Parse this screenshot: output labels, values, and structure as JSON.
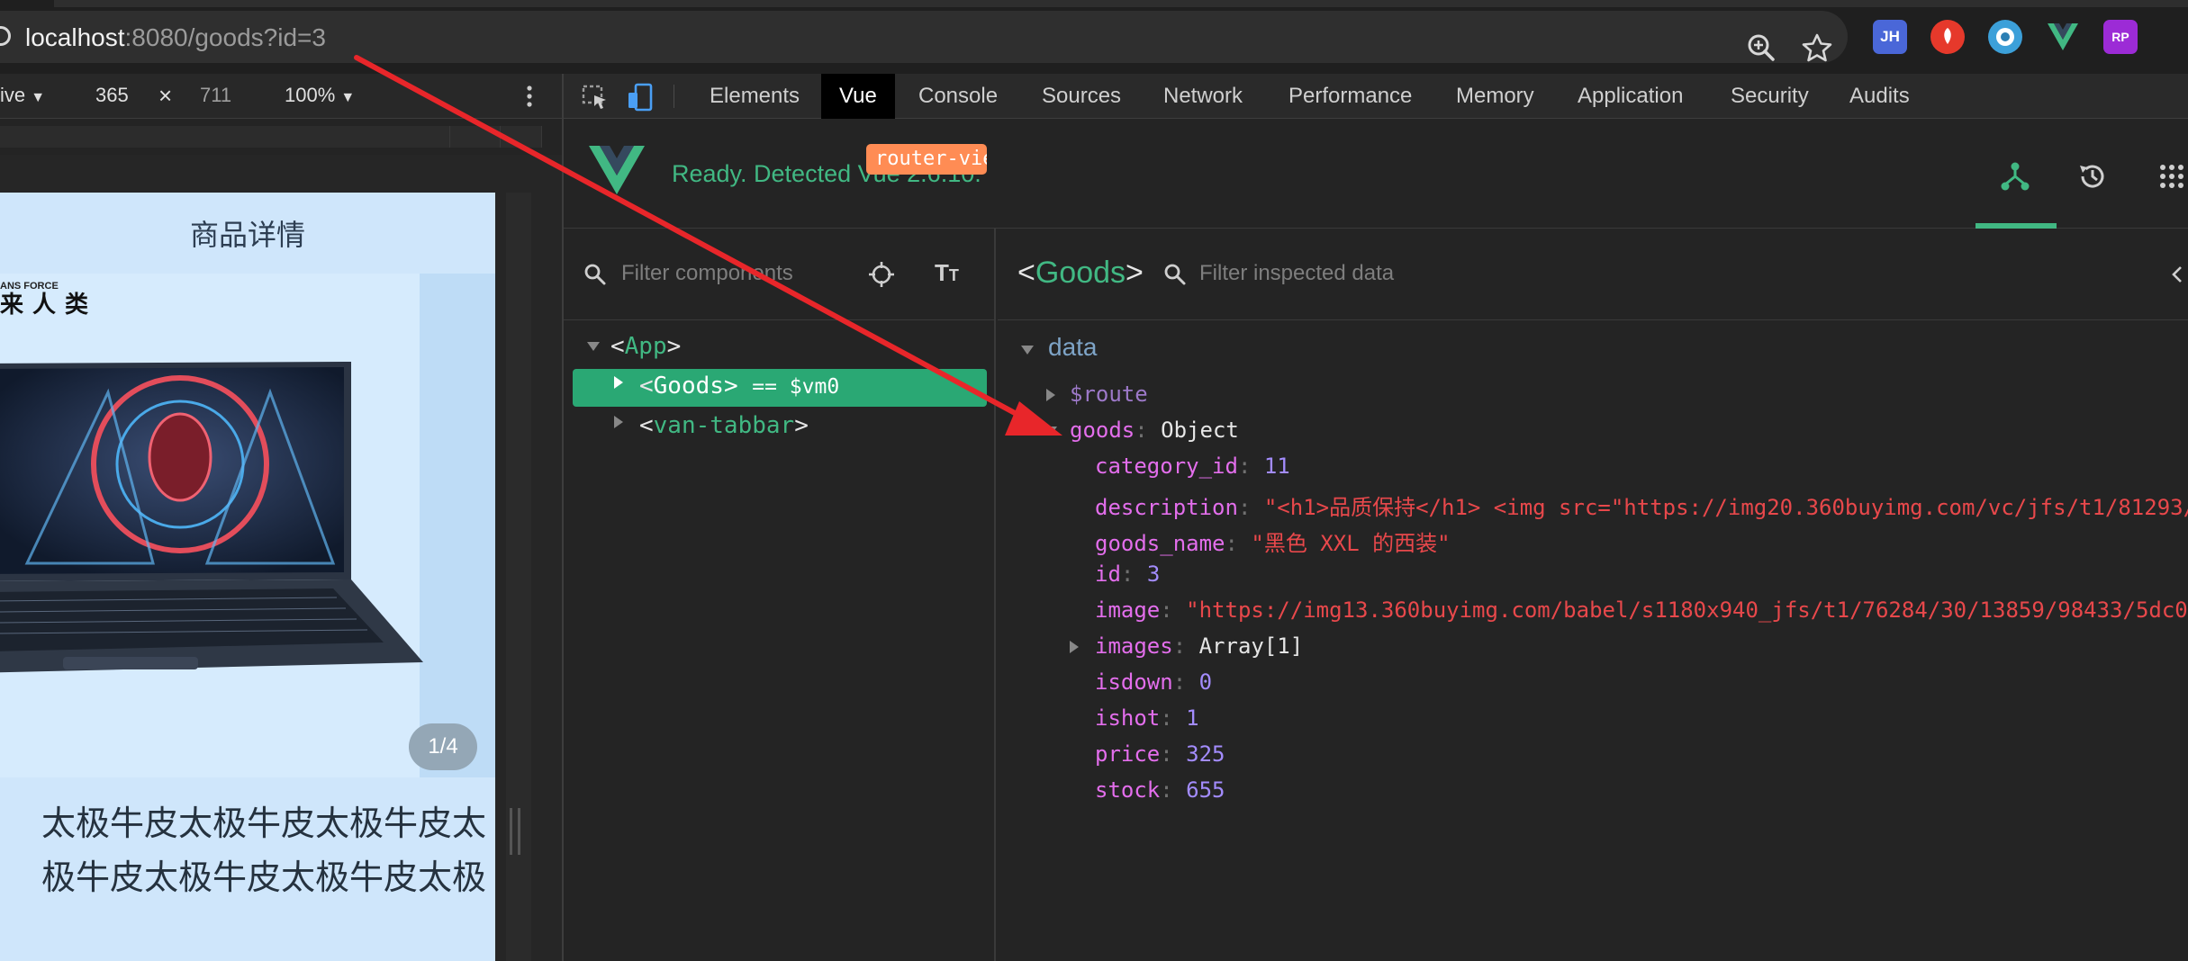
{
  "browser": {
    "url_host": "localhost",
    "url_rest": ":8080/goods?id=3",
    "extensions": [
      {
        "name": "jh-extension-icon",
        "label": "JH",
        "color": "#4a67d8"
      },
      {
        "name": "rocket-extension-icon",
        "label": "",
        "color": "#e6392b"
      },
      {
        "name": "eye-extension-icon",
        "label": "",
        "color": "#3ca0d9"
      },
      {
        "name": "vue-devtools-extension-icon",
        "label": "",
        "color": "#41b883"
      },
      {
        "name": "rp-extension-icon",
        "label": "RP",
        "color": "#9c2bd6"
      }
    ]
  },
  "device_toolbar": {
    "mode": "ive",
    "width": "365",
    "times": "×",
    "height": "711",
    "zoom": "100%"
  },
  "phone": {
    "title": "商品详情",
    "brand_small": "ANS FORCE",
    "brand": "来人类",
    "indicator": "1/4",
    "description_line1": "太极牛皮太极牛皮太极牛皮太",
    "description_line2": "极牛皮太极牛皮太极牛皮太极"
  },
  "devtools": {
    "tabs": [
      "Elements",
      "Vue",
      "Console",
      "Sources",
      "Network",
      "Performance",
      "Memory",
      "Application",
      "Security",
      "Audits"
    ],
    "active_tab": "Vue"
  },
  "vue": {
    "ready_text": "Ready. Detected Vue 2.6.10.",
    "filter_components_placeholder": "Filter components",
    "filter_data_placeholder": "Filter inspected data",
    "selected_component": "Goods",
    "tree": {
      "root": "App",
      "selected": "Goods",
      "selected_ref": "== $vm0",
      "badge": "router-view",
      "sibling": "van-tabbar"
    },
    "data_section": "data",
    "props": {
      "route_key": "$route",
      "goods_key": "goods",
      "goods_type": "Object",
      "fields": [
        {
          "key": "category_id",
          "value": "11",
          "kind": "num"
        },
        {
          "key": "description",
          "value": "\"<h1>品质保持</h1> <img src=\"https://img20.360buyimg.com/vc/jfs/t1/81293/",
          "kind": "str"
        },
        {
          "key": "goods_name",
          "value": "\"黑色 XXL 的西装\"",
          "kind": "str"
        },
        {
          "key": "id",
          "value": "3",
          "kind": "num"
        },
        {
          "key": "image",
          "value": "\"https://img13.360buyimg.com/babel/s1180x940_jfs/t1/76284/30/13859/98433/5dc0",
          "kind": "str"
        },
        {
          "key": "images",
          "value": "Array[1]",
          "kind": "obj"
        },
        {
          "key": "isdown",
          "value": "0",
          "kind": "num"
        },
        {
          "key": "ishot",
          "value": "1",
          "kind": "num"
        },
        {
          "key": "price",
          "value": "325",
          "kind": "num"
        },
        {
          "key": "stock",
          "value": "655",
          "kind": "num"
        }
      ]
    }
  },
  "colors": {
    "vue_green": "#41b883",
    "annotation_arrow": "#e8262a"
  }
}
